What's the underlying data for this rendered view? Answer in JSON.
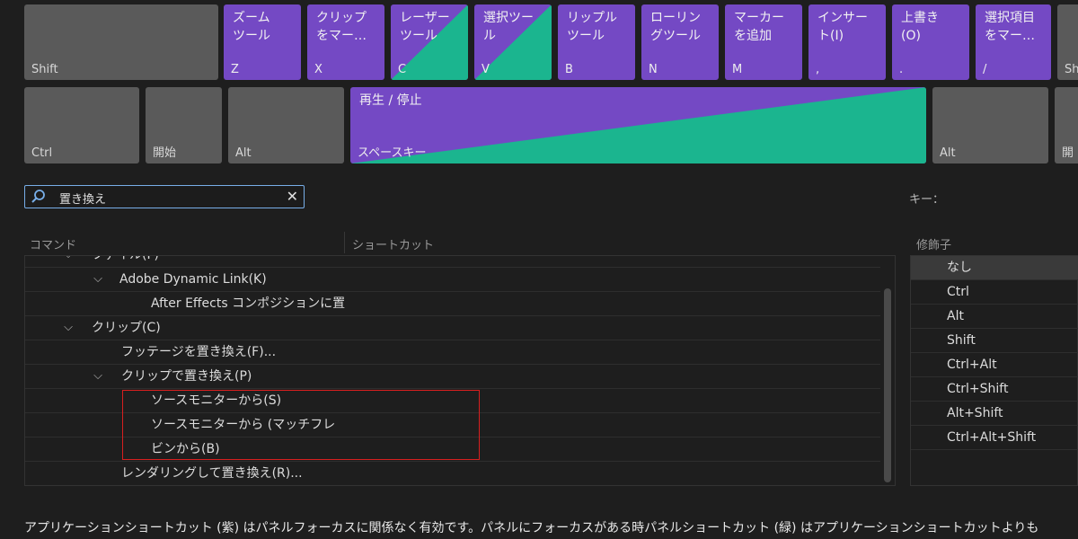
{
  "colors": {
    "app_shortcut": "#7449c4",
    "panel_shortcut": "#1bb58f",
    "unassigned_key": "#5a5a5a",
    "search_border": "#78aee8",
    "highlight_box": "#d81f1f"
  },
  "keyboard": {
    "row1": [
      {
        "cap": "Shift",
        "cmd": ""
      },
      {
        "cap": "Z",
        "cmd": "ズーム\nツール"
      },
      {
        "cap": "X",
        "cmd": "クリップ\nをマー…"
      },
      {
        "cap": "C",
        "cmd": "レーザー\nツール"
      },
      {
        "cap": "V",
        "cmd": "選択ツー\nル"
      },
      {
        "cap": "B",
        "cmd": "リップル\nツール"
      },
      {
        "cap": "N",
        "cmd": "ローリン\nグツール"
      },
      {
        "cap": "M",
        "cmd": "マーカー\nを追加"
      },
      {
        "cap": ",",
        "cmd": "インサー\nト(I)"
      },
      {
        "cap": ".",
        "cmd": "上書き\n(O)"
      },
      {
        "cap": "/",
        "cmd": "選択項目\nをマー…"
      },
      {
        "cap": "Sh",
        "cmd": ""
      }
    ],
    "row2": [
      {
        "cap": "Ctrl",
        "cmd": ""
      },
      {
        "cap": "開始",
        "cmd": ""
      },
      {
        "cap": "Alt",
        "cmd": ""
      },
      {
        "cap": "スペースキー",
        "cmd": "再生 / 停止"
      },
      {
        "cap": "Alt",
        "cmd": ""
      },
      {
        "cap": "開",
        "cmd": ""
      }
    ]
  },
  "search": {
    "value": "置き換え",
    "clear_icon": "close-icon"
  },
  "key_label": "キー：",
  "headers": {
    "command": "コマンド",
    "shortcut": "ショートカット",
    "modifier": "修飾子"
  },
  "tree": [
    {
      "label": "ファイル(F)",
      "chevron": "⌵"
    },
    {
      "label": "Adobe Dynamic Link(K)",
      "chevron": "⌵"
    },
    {
      "label": "After Effects コンポジションに置",
      "chevron": ""
    },
    {
      "label": "クリップ(C)",
      "chevron": "⌵"
    },
    {
      "label": "フッテージを置き換え(F)...",
      "chevron": ""
    },
    {
      "label": "クリップで置き換え(P)",
      "chevron": "⌵"
    },
    {
      "label": "ソースモニターから(S)",
      "chevron": ""
    },
    {
      "label": "ソースモニターから (マッチフレ",
      "chevron": ""
    },
    {
      "label": "ビンから(B)",
      "chevron": ""
    },
    {
      "label": "レンダリングして置き換え(R)...",
      "chevron": ""
    }
  ],
  "modifiers": [
    "なし",
    "Ctrl",
    "Alt",
    "Shift",
    "Ctrl+Alt",
    "Ctrl+Shift",
    "Alt+Shift",
    "Ctrl+Alt+Shift"
  ],
  "footer": "アプリケーションショートカット (紫) はパネルフォーカスに関係なく有効です。パネルにフォーカスがある時パネルショートカット (緑) はアプリケーションショートカットよりも"
}
